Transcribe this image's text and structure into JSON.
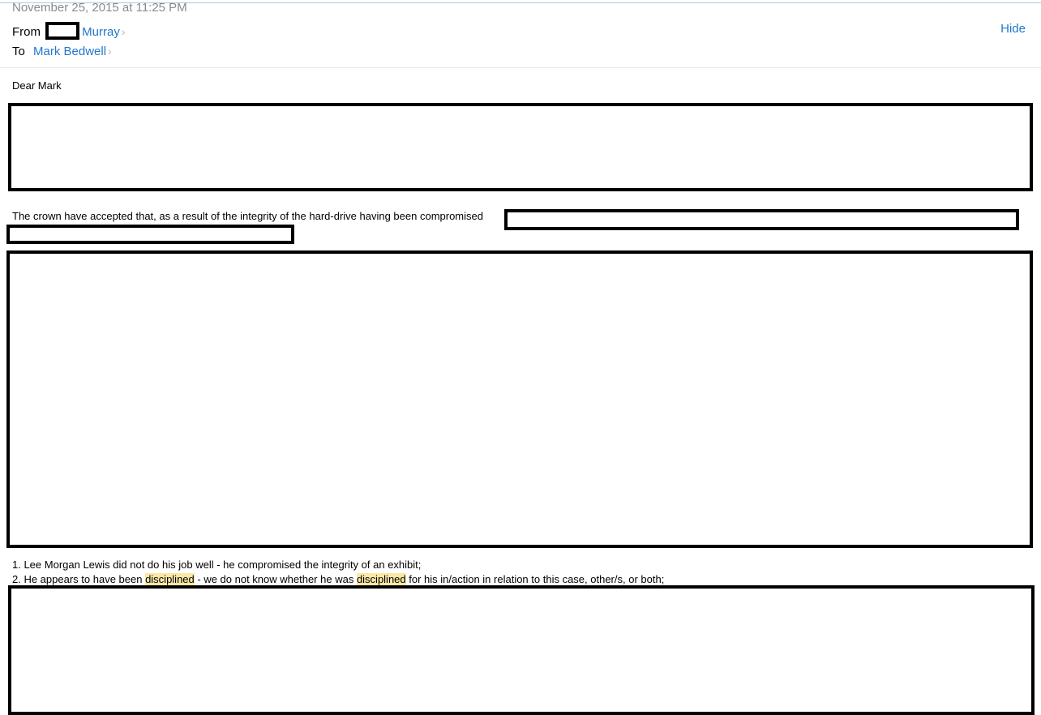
{
  "header": {
    "date": "November 25, 2015 at 11:25 PM",
    "from_label": "From",
    "from_name": "Murray",
    "to_label": "To",
    "to_name": "Mark Bedwell",
    "hide_label": "Hide",
    "chevron": ">"
  },
  "body": {
    "greeting": "Dear Mark",
    "paragraph1": "The crown have accepted that, as a result of the integrity of the hard-drive having been compromised",
    "item1": "1. Lee Morgan Lewis did not do his job well - he compromised the integrity of an exhibit;",
    "item2": {
      "part1": "2. He appears to have been ",
      "highlight1": "disciplined",
      "part2": " - we do not know whether he was ",
      "highlight2": "disciplined",
      "part3": " for his in/action in relation to this case, other/s, or both;"
    }
  },
  "colors": {
    "link": "#2277cc",
    "highlight": "#fbe7a6",
    "date": "#8a8a8a"
  }
}
